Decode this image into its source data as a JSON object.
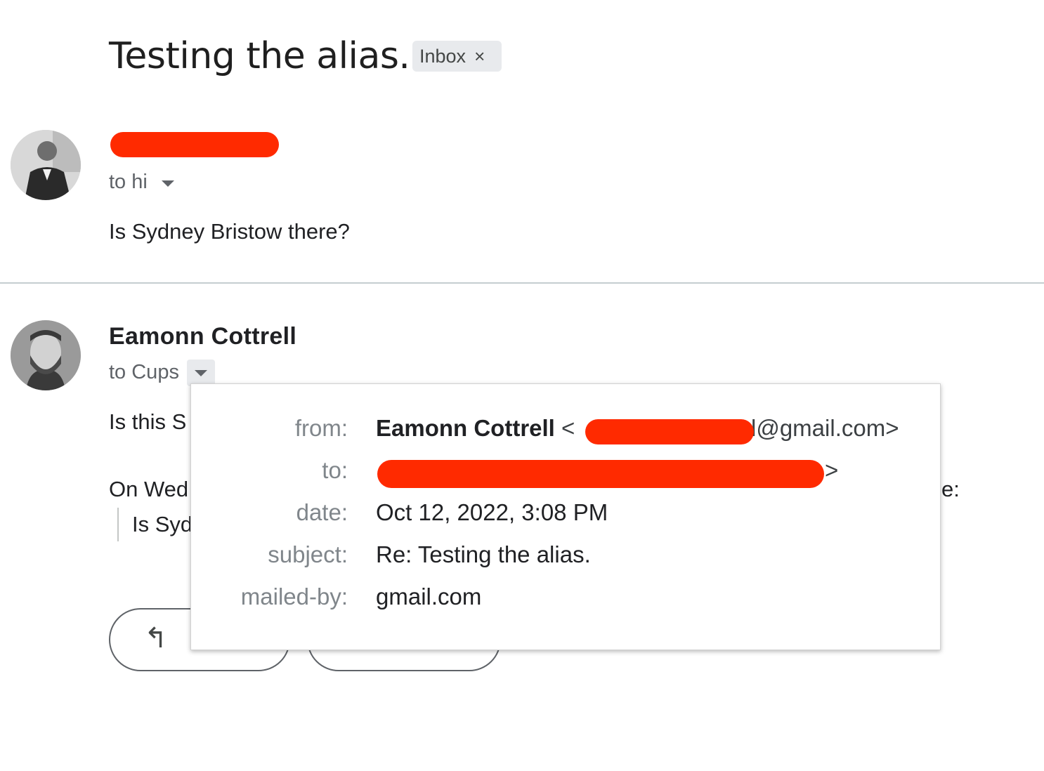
{
  "thread": {
    "subject": "Testing the alias.",
    "label": "Inbox",
    "label_remove": "×"
  },
  "message1": {
    "recipient": "to hi",
    "body": "Is Sydney Bristow there?",
    "avatar_icon": "profile-photo-icon"
  },
  "message2": {
    "sender": "Eamonn Cottrell",
    "recipient": "to Cups",
    "body_partial": "Is this S",
    "quote_intro_partial": "On Wed",
    "quote_intro_end": "e:",
    "quote_body_partial": "Is Syd",
    "avatar_icon": "profile-photo-icon"
  },
  "actions": {
    "reply_icon": "reply-arrow-icon",
    "reply_glyph": "↰"
  },
  "details_popup": {
    "from_label": "from:",
    "from_name": "Eamonn Cottrell",
    "from_open": "<",
    "from_email_suffix": "l@gmail.com>",
    "to_label": "to:",
    "to_close": ">",
    "date_label": "date:",
    "date_value": "Oct 12, 2022, 3:08 PM",
    "subject_label": "subject:",
    "subject_value": "Re: Testing the alias.",
    "mailedby_label": "mailed-by:",
    "mailedby_value": "gmail.com"
  },
  "colors": {
    "redaction": "#ff2a00",
    "chip_bg": "#e8eaed",
    "muted_text": "#5f6368"
  }
}
